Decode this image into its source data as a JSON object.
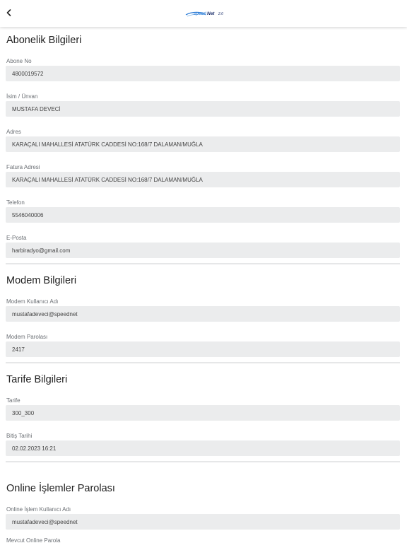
{
  "header": {
    "back_icon": "chevron-left-icon",
    "logo_text": "SpeedNet",
    "logo_suffix": "2.0",
    "brand_color": "#2a7bd6"
  },
  "subscription": {
    "title": "Abonelik Bilgileri",
    "fields": [
      {
        "label": "Abone No",
        "value": "4800019572"
      },
      {
        "label": "İsim / Ünvan",
        "value": "MUSTAFA DEVECİ"
      },
      {
        "label": "Adres",
        "value": "KARAÇALI MAHALLESİ ATATÜRK CADDESİ NO:168/7 DALAMAN/MUĞLA"
      },
      {
        "label": "Fatura Adresi",
        "value": "KARAÇALI MAHALLESİ ATATÜRK CADDESİ NO:168/7 DALAMAN/MUĞLA"
      },
      {
        "label": "Telefon",
        "value": "5546040006"
      },
      {
        "label": "E-Posta",
        "value": "harbiradyo@gmail.com"
      }
    ]
  },
  "modem": {
    "title": "Modem Bilgileri",
    "fields": [
      {
        "label": "Modem Kullanıcı Adı",
        "value": "mustafadeveci@speednet"
      },
      {
        "label": "Modem Parolası",
        "value": "2417"
      }
    ]
  },
  "tariff": {
    "title": "Tarife Bilgileri",
    "fields": [
      {
        "label": "Tarife",
        "value": "300_300"
      },
      {
        "label": "Bitiş Tarihi",
        "value": "02.02.2023 16:21"
      }
    ]
  },
  "online": {
    "title": "Online İşlemler Parolası",
    "fields": [
      {
        "label": "Online İşlem Kullanıcı Adı",
        "value": "mustafadeveci@speednet"
      },
      {
        "label": "Mevcut Online Parola",
        "value": ""
      }
    ]
  }
}
